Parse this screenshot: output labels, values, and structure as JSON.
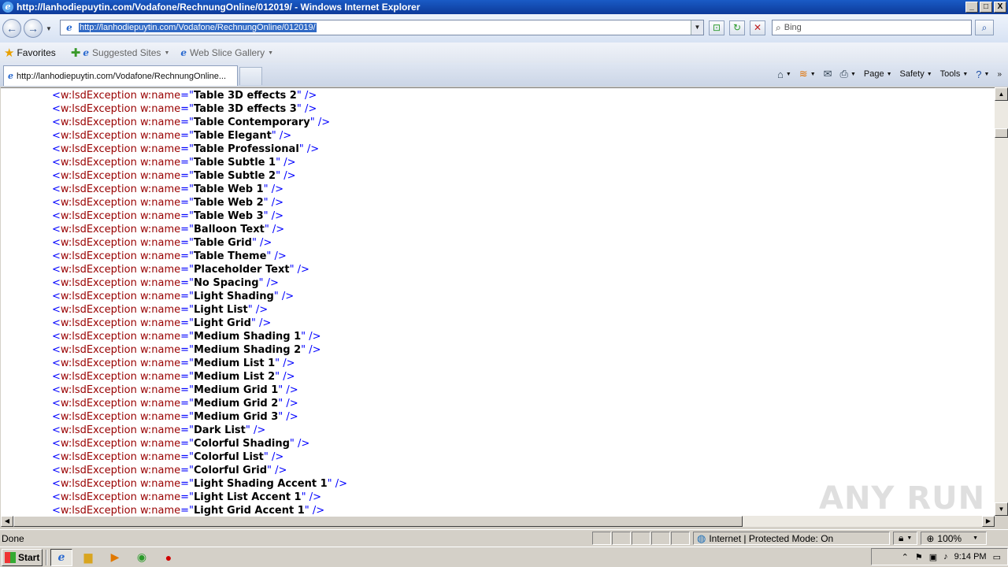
{
  "window": {
    "title": "http://lanhodiepuytin.com/Vodafone/RechnungOnline/012019/ - Windows Internet Explorer",
    "min": "_",
    "max": "□",
    "close": "X"
  },
  "nav": {
    "back": "←",
    "forward": "→",
    "url": "http://lanhodiepuytin.com/Vodafone/RechnungOnline/012019/",
    "search_placeholder": "Bing",
    "compat_icon": "compat-view-icon",
    "refresh": "↻",
    "stop": "✕"
  },
  "favbar": {
    "favorites": "Favorites",
    "suggested": "Suggested Sites",
    "webslice": "Web Slice Gallery"
  },
  "tabs": [
    {
      "label": "http://lanhodiepuytin.com/Vodafone/RechnungOnline..."
    }
  ],
  "commands": {
    "page": "Page",
    "safety": "Safety",
    "tools": "Tools"
  },
  "code": {
    "tag": "w:lsdException",
    "attr": "w:name",
    "names": [
      "Table 3D effects 2",
      "Table 3D effects 3",
      "Table Contemporary",
      "Table Elegant",
      "Table Professional",
      "Table Subtle 1",
      "Table Subtle 2",
      "Table Web 1",
      "Table Web 2",
      "Table Web 3",
      "Balloon Text",
      "Table Grid",
      "Table Theme",
      "Placeholder Text",
      "No Spacing",
      "Light Shading",
      "Light List",
      "Light Grid",
      "Medium Shading 1",
      "Medium Shading 2",
      "Medium List 1",
      "Medium List 2",
      "Medium Grid 1",
      "Medium Grid 2",
      "Medium Grid 3",
      "Dark List",
      "Colorful Shading",
      "Colorful List",
      "Colorful Grid",
      "Light Shading Accent 1",
      "Light List Accent 1",
      "Light Grid Accent 1"
    ]
  },
  "watermark": "ANY RUN",
  "status": {
    "text": "Done",
    "zone": "Internet | Protected Mode: On",
    "zoom": "100%"
  },
  "taskbar": {
    "start": "Start",
    "clock": "9:14 PM"
  }
}
